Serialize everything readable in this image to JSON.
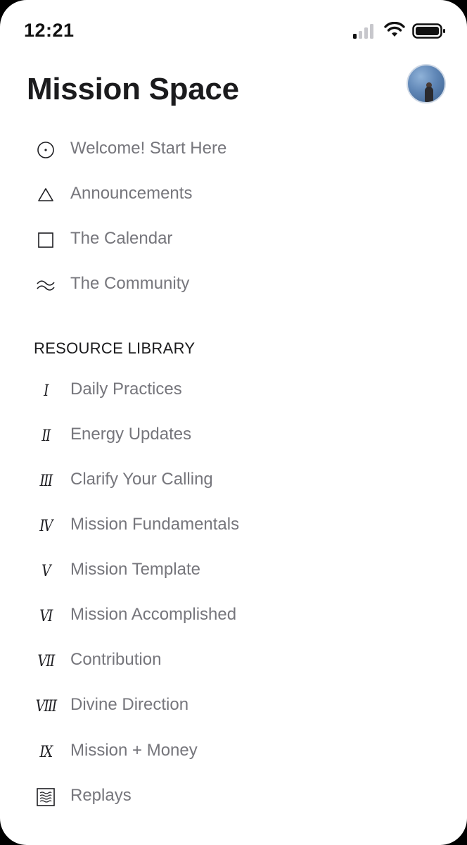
{
  "status_bar": {
    "time": "12:21"
  },
  "header": {
    "title": "Mission Space"
  },
  "main_nav": [
    {
      "label": "Welcome! Start Here",
      "icon": "circle-dot-icon"
    },
    {
      "label": "Announcements",
      "icon": "triangle-icon"
    },
    {
      "label": "The Calendar",
      "icon": "square-icon"
    },
    {
      "label": "The Community",
      "icon": "approx-waves-icon"
    }
  ],
  "resource_library": {
    "title": "RESOURCE LIBRARY",
    "items": [
      {
        "label": "Daily Practices",
        "numeral": "I"
      },
      {
        "label": "Energy Updates",
        "numeral": "II"
      },
      {
        "label": "Clarify Your Calling",
        "numeral": "III"
      },
      {
        "label": "Mission Fundamentals",
        "numeral": "IV"
      },
      {
        "label": "Mission Template",
        "numeral": "V"
      },
      {
        "label": "Mission Accomplished",
        "numeral": "VI"
      },
      {
        "label": "Contribution",
        "numeral": "VII"
      },
      {
        "label": "Divine Direction",
        "numeral": "VIII"
      },
      {
        "label": "Mission + Money",
        "numeral": "IX"
      },
      {
        "label": "Replays",
        "icon": "document-lines-icon"
      }
    ]
  }
}
